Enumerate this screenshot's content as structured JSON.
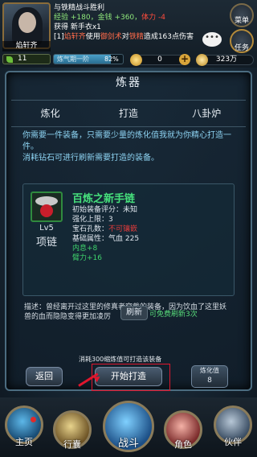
{
  "player": {
    "name": "焰轩齐",
    "level": "11"
  },
  "log": [
    {
      "text": "与铁精战斗胜利",
      "color": "#ffffff"
    },
    {
      "parts": [
        {
          "text": "经验 +180，金钱 +360，",
          "color": "#8fe87b"
        },
        {
          "text": "体力 -4",
          "color": "#ff4c3c"
        }
      ]
    },
    {
      "text": "获得 新手衣x1",
      "color": "#ffffff"
    },
    {
      "parts": [
        {
          "text": "[1]",
          "color": "#ffffff"
        },
        {
          "text": "焰轩齐",
          "color": "#ff6b4a"
        },
        {
          "text": "使用",
          "color": "#ffffff"
        },
        {
          "text": "御剑术",
          "color": "#ff6b4a"
        },
        {
          "text": "对",
          "color": "#ffffff"
        },
        {
          "text": "铁精",
          "color": "#ff6b4a"
        },
        {
          "text": "造成163点伤害",
          "color": "#ffffff"
        }
      ]
    }
  ],
  "exp": {
    "label": "炼气期一阶",
    "percent_text": "82%",
    "percent": 82
  },
  "resources": {
    "gold": "0",
    "silver": "323万"
  },
  "top_buttons": {
    "menu": "菜单",
    "task": "任务"
  },
  "chat_icon": "•••",
  "panel": {
    "title": "炼器",
    "tabs": [
      "炼化",
      "打造",
      "八卦炉"
    ],
    "description": "你需要一件装备，只需要少量的炼化值我就为你精心打造一件。\n消耗钻石可进行刷新需要打造的装备。",
    "item": {
      "name": "百炼之新手链",
      "level": "Lv5",
      "type": "项链",
      "stats": [
        {
          "text": "初始装备评分：未知",
          "color": "#dfe6ee"
        },
        {
          "text": "强化上限：3",
          "color": "#dfe6ee"
        },
        {
          "parts": [
            {
              "text": "宝石孔数：",
              "color": "#dfe6ee"
            },
            {
              "text": "不可镶嵌",
              "color": "#e23b3b"
            }
          ]
        },
        {
          "text": "基础属性：气血 225",
          "color": "#dfe6ee"
        },
        {
          "text": "内息+8",
          "color": "#3fd36c"
        },
        {
          "text": "臂力+16",
          "color": "#3fd36c"
        }
      ]
    },
    "item_description": "描述：曾经离开过这里的修真者穿戴的装备，因为饮血了这里妖兽的血而隐隐变得更加凌厉",
    "refresh_label": "刷新",
    "free_refresh": "可免费刷新3次",
    "cost_note": "消耗300缩炼值可打造该装备",
    "back_label": "返回",
    "start_label": "开始打造",
    "refine_label": "炼化值",
    "refine_value": "8"
  },
  "nav": [
    "主页",
    "行囊",
    "战斗",
    "角色",
    "伙伴"
  ],
  "colors": {
    "accent": "#e0162d",
    "gold": "#d8a43a"
  }
}
